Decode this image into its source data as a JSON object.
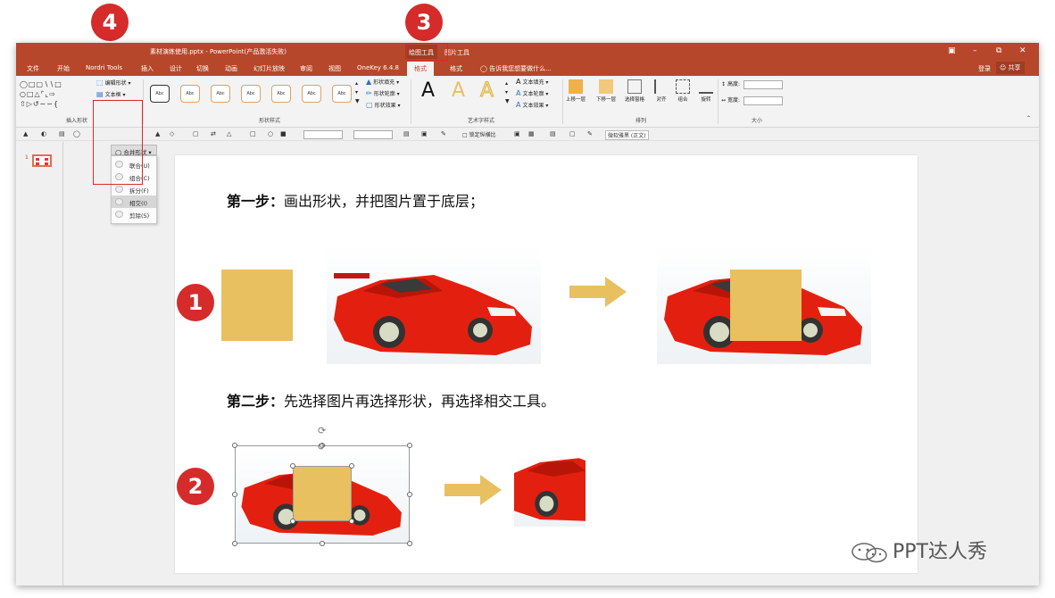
{
  "window": {
    "title": "素材演练使用.pptx - PowerPoint(产品激活失败)",
    "contextual_tabs": [
      "绘图工具",
      "图片工具"
    ]
  },
  "tabs": [
    "文件",
    "开始",
    "Nordri Tools",
    "插入",
    "设计",
    "切换",
    "动画",
    "幻灯片放映",
    "审阅",
    "视图",
    "OneKey 6.4.8",
    "格式",
    "格式"
  ],
  "tell_me": "告诉我您想要做什么...",
  "account": {
    "login": "登录",
    "share": "共享"
  },
  "ribbon": {
    "insert_shapes": {
      "label": "插入形状",
      "edit_shape": "编辑形状",
      "text_box": "文本框",
      "merge_shapes": "合并形状"
    },
    "shape_styles": {
      "label": "形状样式",
      "sample": "Abc",
      "fill": "形状填充",
      "outline": "形状轮廓",
      "effects": "形状效果"
    },
    "wordart": {
      "label": "艺术字样式",
      "letter": "A",
      "text_fill": "文本填充",
      "text_outline": "文本轮廓",
      "text_effects": "文本效果"
    },
    "arrange": {
      "label": "排列",
      "buttons": [
        "上移一层",
        "下移一层",
        "选择窗格",
        "对齐",
        "组合",
        "旋转"
      ]
    },
    "size": {
      "label": "大小",
      "height": "高度:",
      "width": "宽度:"
    }
  },
  "qat": {
    "lock_ratio": "锁定纵横比",
    "font": "微软雅黑 (正文)"
  },
  "merge_menu": [
    "联合(U)",
    "组合(C)",
    "拆分(F)",
    "相交(I)",
    "剪除(S)"
  ],
  "merge_menu_highlight": 3,
  "thumbnail": {
    "number": "1"
  },
  "slide": {
    "step1_bold": "第一步：",
    "step1_text": "画出形状，并把图片置于底层；",
    "step2_bold": "第二步：",
    "step2_text": "先选择图片再选择形状，再选择相交工具。"
  },
  "callouts": [
    "1",
    "2",
    "3",
    "4"
  ],
  "watermark": "PPT达人秀",
  "colors": {
    "ppt_red": "#b7472a",
    "callout_red": "#d52b2b",
    "shape_gold": "#e8c060",
    "car_red": "#e3200f"
  }
}
